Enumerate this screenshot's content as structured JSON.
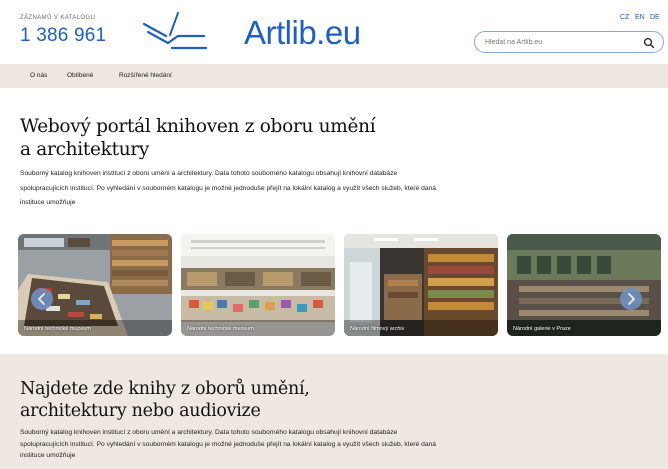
{
  "header": {
    "count_label": "ZÁZNAMŮ V KATALOGU",
    "count_value": "1 386 961",
    "logo_text": "Artlib.eu",
    "languages": [
      "CZ",
      "EN",
      "DE"
    ],
    "search_placeholder": "Hledat na Artlib.eu",
    "accent_color": "#1f5fbf"
  },
  "nav": {
    "items": [
      "O nás",
      "Oblíbené",
      "Rozšířené hledání"
    ]
  },
  "intro": {
    "title_line1": "Webový portál knihoven z oboru umění",
    "title_line2": "a architektury",
    "text_line1": "Souborný katalog knihoven institucí z oboru umění a architektury. Data tohoto souborného katalogu obsahují knihovní databáze",
    "text_line2": "spolupracujících institucí. Po vyhledání v souborném katalogu je možné jednoduše přejít na lokální katalog a využít všech služeb, které daná",
    "text_line3": "instituce umožňuje"
  },
  "carousel": {
    "slides": [
      {
        "caption": "Národní technické muzeum"
      },
      {
        "caption": "Národní technické muzeum"
      },
      {
        "caption": "Národní filmový archiv"
      },
      {
        "caption": "Národní galerie v Praze"
      }
    ]
  },
  "section2": {
    "title_line1": "Najdete zde knihy z oborů umění,",
    "title_line2": "architektury nebo audiovize",
    "text_line1": "Souborný katalog knihoven institucí z oboru umění a architektury. Data tohoto souborného katalogu obsahují knihovní databáze",
    "text_line2": "spolupracujících institucí. Po vyhledání v souborném katalogu je možné jednoduše přejít na lokální katalog a využít všech služeb, které daná",
    "text_line3": "instituce umožňuje"
  }
}
